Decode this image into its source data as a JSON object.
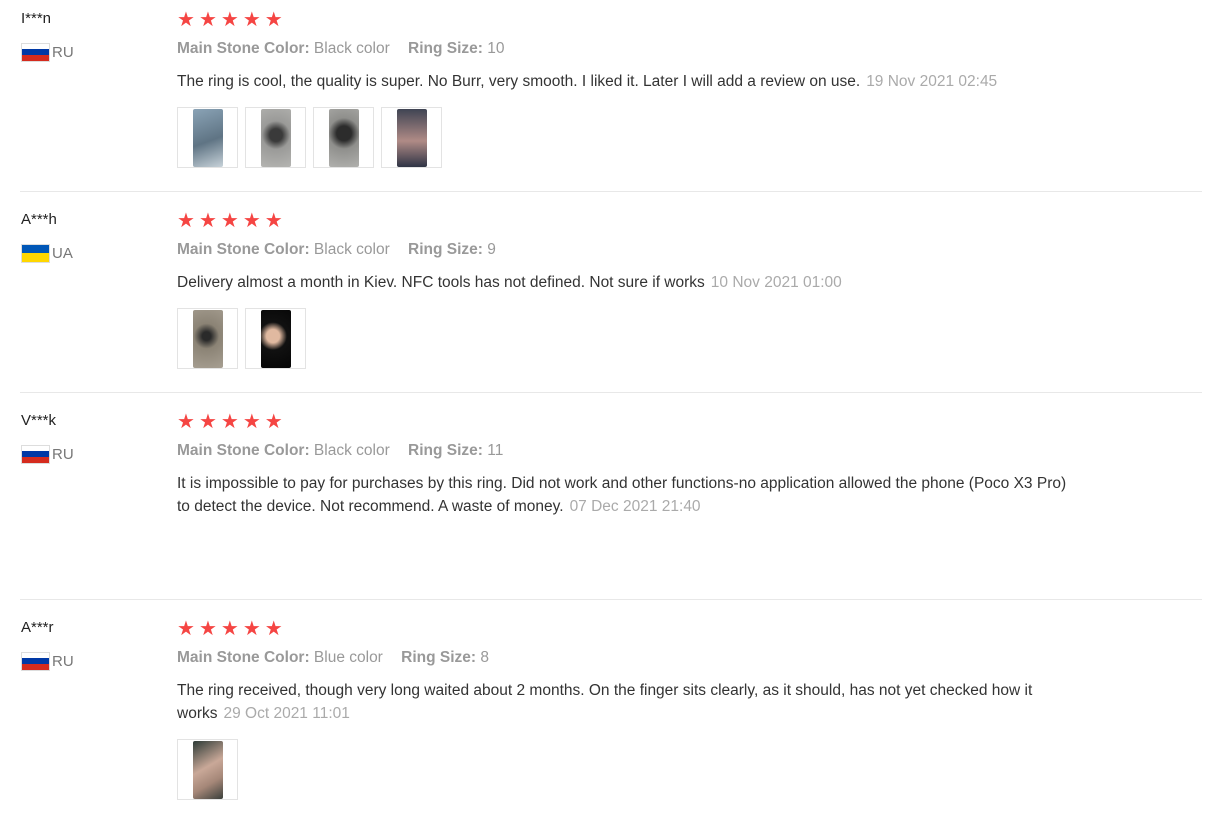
{
  "reviews": [
    {
      "user": "I***n",
      "country": "RU",
      "flag": [
        "#ffffff",
        "#0039a6",
        "#d52b1e"
      ],
      "stars": 5,
      "color_label": "Main Stone Color:",
      "color_value": "Black color",
      "size_label": "Ring Size:",
      "size_value": "10",
      "text": "The ring is cool, the quality is super. No Burr, very smooth. I liked it. Later I will add a review on use.",
      "date": "19 Nov 2021 02:45",
      "photos": [
        {
          "name": "ring-photo-1",
          "bg": "linear-gradient(160deg,#8aa3b6,#5f7484 55%,#c7d2d9)"
        },
        {
          "name": "ring-photo-2",
          "bg": "radial-gradient(circle at 50% 45%,#3a3a3a 18%,#9a9a98 40%,#b4b4b1)"
        },
        {
          "name": "ring-photo-3",
          "bg": "radial-gradient(circle at 50% 42%,#2c2c2c 20%,#8f8f8c 42%,#b0b0ad)"
        },
        {
          "name": "ring-photo-4",
          "bg": "linear-gradient(180deg,#3f4453,#b08b86 55%,#2f3445)"
        }
      ]
    },
    {
      "user": "A***h",
      "country": "UA",
      "flag": [
        "#0057b7",
        "#ffd700"
      ],
      "stars": 5,
      "color_label": "Main Stone Color:",
      "color_value": "Black color",
      "size_label": "Ring Size:",
      "size_value": "9",
      "text": "Delivery almost a month in Kiev. NFC tools has not defined. Not sure if works",
      "date": "10 Nov 2021 01:00",
      "photos": [
        {
          "name": "ring-photo-1",
          "bg": "radial-gradient(circle at 45% 45%,#2a2a2a 12%,#8b8375 35%,#a79f92)"
        },
        {
          "name": "ring-photo-2",
          "bg": "radial-gradient(circle at 40% 45%,#e0b9a0 18%,#111 38%,#050505)"
        }
      ]
    },
    {
      "user": "V***k",
      "country": "RU",
      "flag": [
        "#ffffff",
        "#0039a6",
        "#d52b1e"
      ],
      "stars": 5,
      "color_label": "Main Stone Color:",
      "color_value": "Black color",
      "size_label": "Ring Size:",
      "size_value": "11",
      "text": "It is impossible to pay for purchases by this ring. Did not work and other functions-no application allowed the phone (Poco X3 Pro) to detect the device. Not recommend. A waste of money.",
      "date": "07 Dec 2021 21:40",
      "photos": []
    },
    {
      "user": "A***r",
      "country": "RU",
      "flag": [
        "#ffffff",
        "#0039a6",
        "#d52b1e"
      ],
      "stars": 5,
      "color_label": "Main Stone Color:",
      "color_value": "Blue color",
      "size_label": "Ring Size:",
      "size_value": "8",
      "text": "The ring received, though very long waited about 2 months. On the finger sits clearly, as it should, has not yet checked how it works",
      "date": "29 Oct 2021 11:01",
      "photos": [
        {
          "name": "ring-photo-1",
          "bg": "linear-gradient(150deg,#2d3a36,#c9a898 45%,#a58778 70%,#3a3f3b)"
        }
      ]
    }
  ],
  "colors": {
    "star": "#f54543",
    "muted": "#999999",
    "date": "#aaaaaa"
  }
}
